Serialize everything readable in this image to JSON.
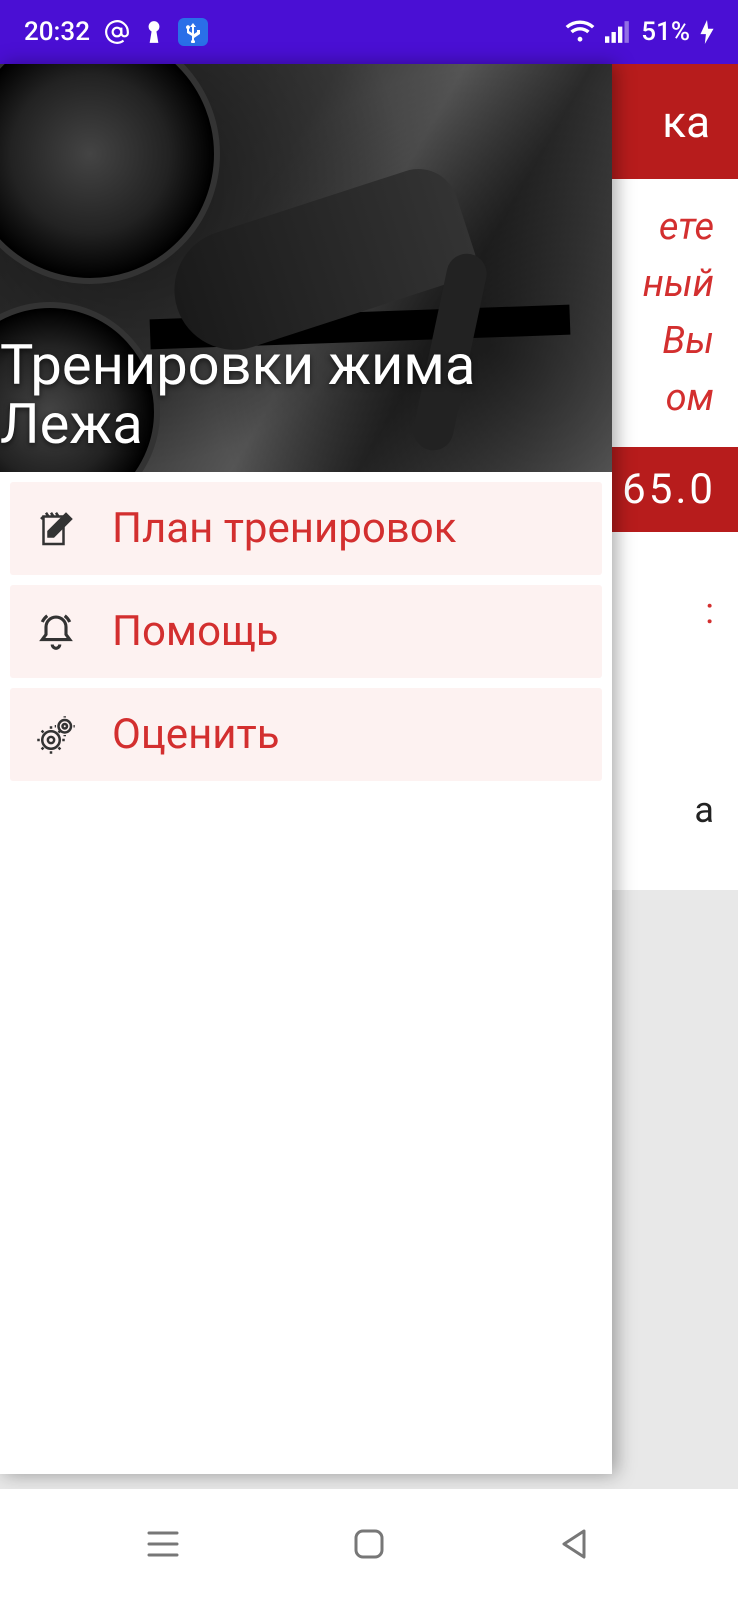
{
  "status": {
    "time": "20:32",
    "battery": "51%"
  },
  "underlay": {
    "header_fragment": "ка",
    "desc_lines": [
      "ете",
      "ный",
      "Вы",
      "ом"
    ],
    "value": "65.0",
    "list_fragments": [
      ":",
      "а"
    ]
  },
  "drawer": {
    "title": "Тренировки жима Лежа",
    "items": [
      {
        "label": "План тренировок",
        "icon": "notepad-icon"
      },
      {
        "label": "Помощь",
        "icon": "bell-icon"
      },
      {
        "label": "Оценить",
        "icon": "gear-icon"
      }
    ]
  }
}
